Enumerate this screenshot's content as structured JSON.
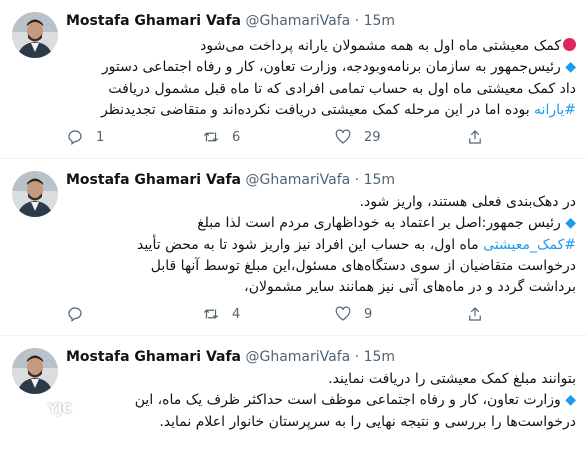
{
  "tweets": [
    {
      "author_name": "Mostafa Ghamari Vafa",
      "handle": "@GhamariVafa",
      "separator": "·",
      "time": "15m",
      "lines": [
        "کمک معیشتی ماه اول به همه مشمولان یارانه پرداخت می‌شود",
        "رئیس‌جمهور به سازمان برنامه‌وبودجه، وزارت تعاون، کار و رفاه اجتماعی دستور",
        "داد کمک معیشتی ماه اول به حساب تمامی افرادی که تا ماه قبل مشمول دریافت",
        "بوده اما در این مرحله کمک معیشتی دریافت نکرده‌اند و متقاضی تجدیدنظر"
      ],
      "hashtag": "#یارانه",
      "replies": "1",
      "retweets": "6",
      "likes": "29"
    },
    {
      "author_name": "Mostafa Ghamari Vafa",
      "handle": "@GhamariVafa",
      "separator": "·",
      "time": "15m",
      "lines": [
        "در دهک‌بندی فعلی هستند، واریز شود.",
        "رئیس جمهور:اصل بر اعتماد به خوداظهاری مردم است لذا مبلغ",
        "ماه اول، به حساب این افراد نیز واریز شود تا به محض تأیید",
        "درخواست متقاضیان از سوی دستگاه‌های مسئول،این مبلغ توسط آنها قابل",
        "برداشت گردد و در ماه‌های آتی نیز همانند سایر مشمولان،"
      ],
      "hashtag": "#کمک_معیشتی",
      "replies": "",
      "retweets": "4",
      "likes": "9"
    },
    {
      "author_name": "Mostafa Ghamari Vafa",
      "handle": "@GhamariVafa",
      "separator": "·",
      "time": "15m",
      "lines": [
        "بتوانند مبلغ کمک معیشتی را دریافت نمایند.",
        "وزارت تعاون، کار و رفاه اجتماعی موظف است حداکثر ظرف یک ماه، این",
        "درخواست‌ها را بررسی و نتیجه نهایی را به سرپرستان خانوار اعلام نماید."
      ]
    }
  ],
  "watermark": {
    "label": "YJC",
    "icon": "yjc-logo-icon"
  },
  "colors": {
    "link": "#1d9bf0",
    "muted": "#536471",
    "accent_dot": "#e0245e",
    "divider": "#eff3f4"
  }
}
